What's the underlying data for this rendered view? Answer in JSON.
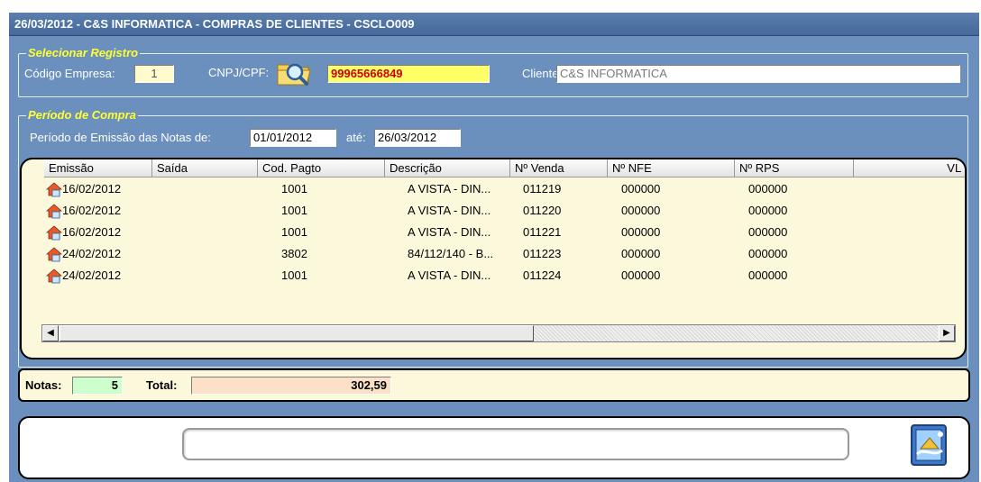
{
  "window": {
    "title": "26/03/2012  -  C&S INFORMATICA  -  COMPRAS DE CLIENTES  -  CSCLO009"
  },
  "selecionar": {
    "legend": "Selecionar Registro",
    "codigo_empresa_label": "Código Empresa:",
    "codigo_empresa_value": "1",
    "cnpj_label": "CNPJ/CPF:",
    "cnpj_value": "99965666849",
    "cliente_label": "Cliente:",
    "cliente_value": "C&S INFORMATICA",
    "search_icon": "magnifier-folder-icon"
  },
  "periodo": {
    "legend": "Período de Compra",
    "label": "Período de Emissão das Notas de:",
    "from": "01/01/2012",
    "ate_label": "até:",
    "to": "26/03/2012"
  },
  "grid": {
    "columns": [
      "Emissão",
      "Saída",
      "Cod. Pagto",
      "Descrição",
      "Nº Venda",
      "Nº NFE",
      "Nº RPS",
      "VL S"
    ],
    "row_icon": "house-document-icon",
    "rows": [
      {
        "emissao": "16/02/2012",
        "saida": "",
        "cod_pagto": "1001",
        "descricao": "A VISTA - DIN...",
        "venda": "011219",
        "nfe": "000000",
        "rps": "000000"
      },
      {
        "emissao": "16/02/2012",
        "saida": "",
        "cod_pagto": "1001",
        "descricao": "A VISTA - DIN...",
        "venda": "011220",
        "nfe": "000000",
        "rps": "000000"
      },
      {
        "emissao": "16/02/2012",
        "saida": "",
        "cod_pagto": "1001",
        "descricao": "A VISTA - DIN...",
        "venda": "011221",
        "nfe": "000000",
        "rps": "000000"
      },
      {
        "emissao": "24/02/2012",
        "saida": "",
        "cod_pagto": "3802",
        "descricao": "84/112/140 - B...",
        "venda": "011223",
        "nfe": "000000",
        "rps": "000000"
      },
      {
        "emissao": "24/02/2012",
        "saida": "",
        "cod_pagto": "1001",
        "descricao": "A VISTA - DIN...",
        "venda": "011224",
        "nfe": "000000",
        "rps": "000000"
      }
    ]
  },
  "totals": {
    "notas_label": "Notas:",
    "notas_value": "5",
    "total_label": "Total:",
    "total_value": "302,59"
  },
  "colors": {
    "window_bg": "#6b90bd",
    "legend_text": "#ffff33",
    "cnpj_bg": "#ffff66",
    "cnpj_text": "#cc0000",
    "notas_bg": "#ccffcc",
    "total_bg": "#fde0c8",
    "grid_bg": "#fbf8dc"
  },
  "bottom": {
    "exit_icon": "exit-door-icon"
  }
}
